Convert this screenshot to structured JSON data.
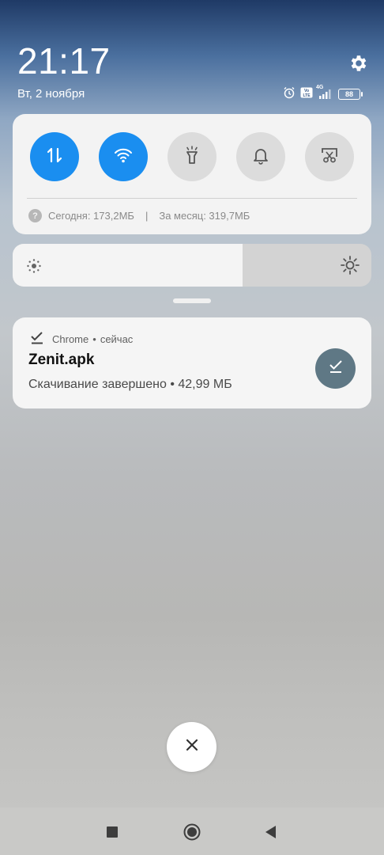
{
  "status": {
    "time": "21:17",
    "date": "Вт, 2 ноября",
    "battery_level": "88",
    "network_label": "4G"
  },
  "quick_settings": {
    "toggles": [
      {
        "name": "mobile-data",
        "icon": "data-arrows-icon",
        "active": true
      },
      {
        "name": "wifi",
        "icon": "wifi-icon",
        "active": true
      },
      {
        "name": "flashlight",
        "icon": "flashlight-icon",
        "active": false
      },
      {
        "name": "sound",
        "icon": "bell-icon",
        "active": false
      },
      {
        "name": "screenshot",
        "icon": "scissors-screenshot-icon",
        "active": false
      }
    ],
    "data_usage": {
      "today": "Сегодня: 173,2МБ",
      "separator": "|",
      "month": "За месяц: 319,7МБ"
    },
    "brightness_level": 0.64,
    "accent_color": "#1a8ef0"
  },
  "notification": {
    "app_name": "Chrome",
    "dot": "•",
    "time": "сейчас",
    "title": "Zenit.apk",
    "text": "Скачивание завершено • 42,99 МБ"
  },
  "navigation": {
    "buttons": [
      "recents",
      "home",
      "back"
    ]
  }
}
